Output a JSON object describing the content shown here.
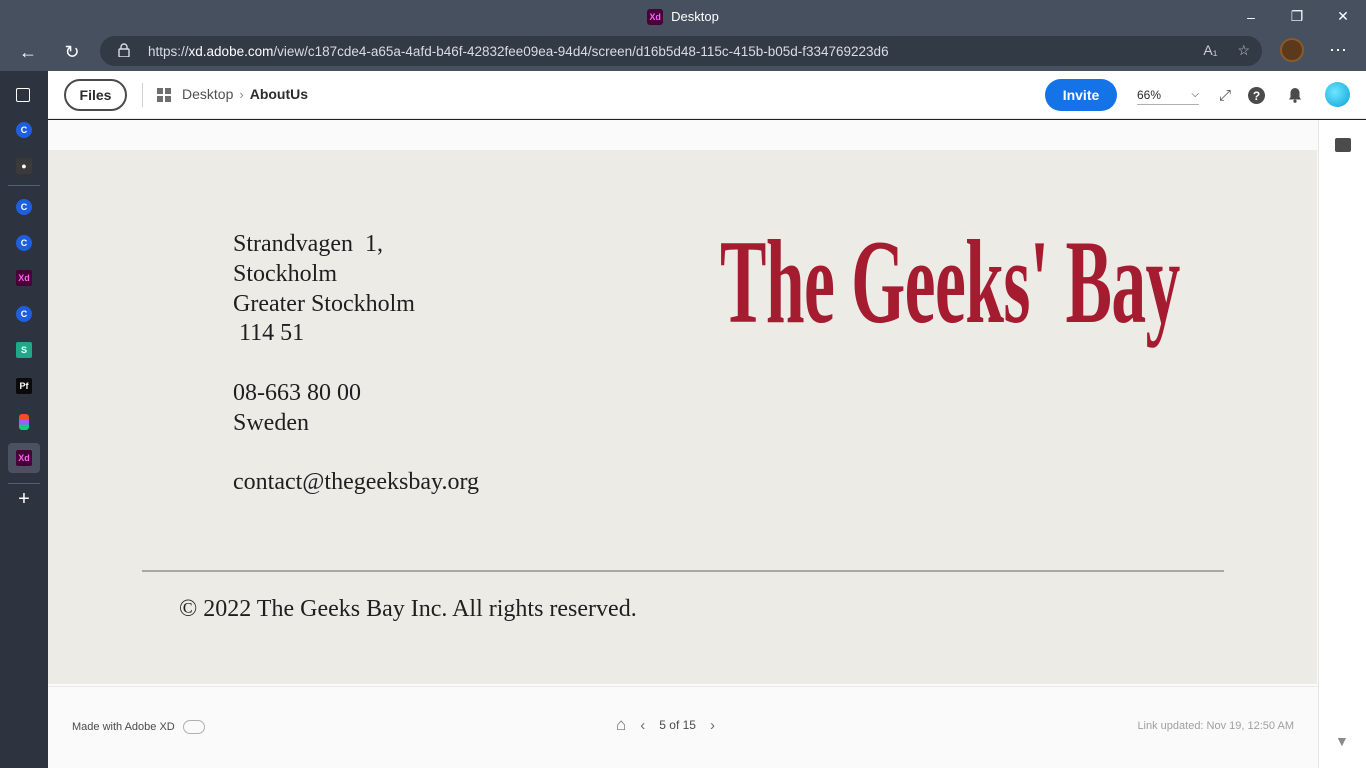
{
  "browser": {
    "tab_title": "Desktop",
    "url_prefix": "https://",
    "url_host": "xd.adobe.com",
    "url_path": "/view/c187cde4-a65a-4afd-b46f-42832fee09ea-94d4/screen/d16b5d48-115c-415b-b05d-f334769223d6"
  },
  "sidebar": {
    "items": [
      {
        "icon": "tabs-icon"
      },
      {
        "icon": "app-c-icon",
        "label": "C"
      },
      {
        "icon": "camera-icon"
      },
      {
        "icon": "app-c-icon",
        "label": "C"
      },
      {
        "icon": "app-c-icon",
        "label": "C"
      },
      {
        "icon": "xd-icon",
        "label": "Xd"
      },
      {
        "icon": "app-c-icon",
        "label": "C"
      },
      {
        "icon": "sk-icon",
        "label": "S"
      },
      {
        "icon": "pf-icon",
        "label": "Pf"
      },
      {
        "icon": "figma-icon"
      },
      {
        "icon": "xd-icon",
        "label": "Xd"
      },
      {
        "icon": "add-icon",
        "label": "+"
      }
    ]
  },
  "header": {
    "files_label": "Files",
    "breadcrumb": [
      "Desktop",
      "AboutUs"
    ],
    "invite_label": "Invite",
    "zoom_value": "66%"
  },
  "artboard": {
    "address_lines": "Strandvagen  1,\nStockholm\nGreater Stockholm\n 114 51\n\n08-663 80 00\nSweden\n\ncontact@thegeeksbay.org",
    "brand": "The Geeks' Bay",
    "copyright": "© 2022 The Geeks Bay Inc. All rights reserved."
  },
  "footer": {
    "made_with": "Made with Adobe XD",
    "pager": "5 of 15",
    "updated": "Link updated: Nov 19, 12:50 AM"
  },
  "colors": {
    "brand_red": "#a51c30",
    "invite_blue": "#1473e6",
    "artboard_bg": "#edebe6"
  }
}
